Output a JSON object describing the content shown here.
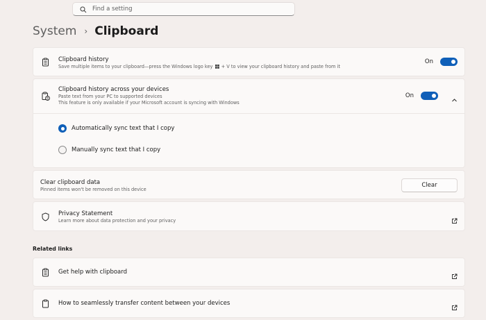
{
  "search": {
    "placeholder": "Find a setting"
  },
  "breadcrumb": {
    "parent": "System",
    "separator": "›",
    "current": "Clipboard"
  },
  "clipboard_history": {
    "title": "Clipboard history",
    "description_before": "Save multiple items to your clipboard—press the Windows logo key",
    "description_after": "+ V to view your clipboard history and paste from it",
    "toggle_label": "On"
  },
  "sync": {
    "title": "Clipboard history across your devices",
    "description_1": "Paste text from your PC to supported devices",
    "description_2": "This feature is only available if your Microsoft account is syncing with Windows",
    "toggle_label": "On",
    "options": [
      {
        "label": "Automatically sync text that I copy",
        "selected": true
      },
      {
        "label": "Manually sync text that I copy",
        "selected": false
      }
    ]
  },
  "clear": {
    "title": "Clear clipboard data",
    "description": "Pinned items won't be removed on this device",
    "button_label": "Clear"
  },
  "privacy": {
    "title": "Privacy Statement",
    "description": "Learn more about data protection and your privacy"
  },
  "related": {
    "heading": "Related links",
    "links": [
      {
        "label": "Get help with clipboard"
      },
      {
        "label": "How to seamlessly transfer content between your devices"
      }
    ]
  },
  "colors": {
    "accent": "#0f5fb8",
    "background": "#f3eeec",
    "card": "#fbf9f8"
  }
}
